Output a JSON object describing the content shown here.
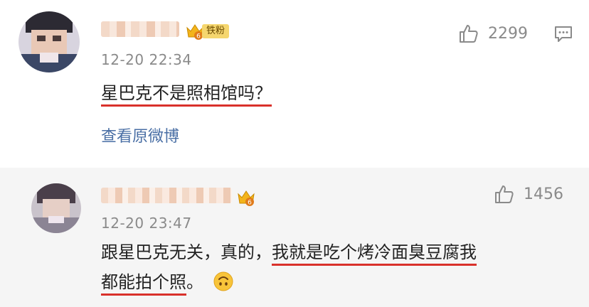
{
  "comments": [
    {
      "username": "",
      "badge_label": "铁粉",
      "badge_level": "6",
      "timestamp": "12-20 22:34",
      "text": "星巴克不是照相馆吗？",
      "like_count": "2299",
      "view_original_label": "查看原微博",
      "icons": [
        "avatar",
        "crown-badge-icon",
        "thumbs-up-icon",
        "comment-icon"
      ]
    },
    {
      "username": "",
      "badge_level": "6",
      "timestamp": "12-20 23:47",
      "text_plain": "跟星巴克无关，真的，",
      "text_underlined_1": "我就是吃个烤冷面臭豆腐我",
      "text_underlined_2": "都能拍个照",
      "text_tail": "。",
      "like_count": "1456",
      "icons": [
        "avatar",
        "crown-badge-icon",
        "thumbs-up-icon",
        "upside-down-face-emoji-icon"
      ]
    }
  ],
  "colors": {
    "underline": "#d9312b",
    "link": "#4a6fa5",
    "secondary_text": "#8a8a8a",
    "badge_bg": "#f5d66e"
  }
}
